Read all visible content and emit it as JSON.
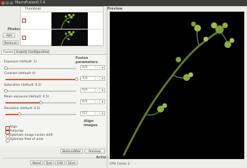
{
  "window": {
    "title": "MacroFusion0.7.4"
  },
  "photos": {
    "label": "Photos",
    "thumbnail_header": "Thumbnail",
    "add_label": "Add",
    "remove_label": "Remove",
    "rows": [
      {
        "checked": true
      },
      {
        "checked": true
      }
    ]
  },
  "tabs": [
    "Fusion",
    "Expert",
    "Configuration"
  ],
  "fusion": {
    "section_title": "Fusion parameters",
    "params": [
      {
        "label": "Exposure (default: 1)",
        "value": "0,0",
        "fraction": 0.0
      },
      {
        "label": "Contrast (default: 0)",
        "value": "1,0",
        "fraction": 1.0
      },
      {
        "label": "Saturation (default: 0.2)",
        "value": "0,0",
        "fraction": 0.0
      },
      {
        "label": "Mean exposure (default: 0.5)",
        "value": "0,5",
        "fraction": 0.5
      },
      {
        "label": "Deviation (default: 0.2)",
        "value": "0,2",
        "fraction": 0.2
      }
    ]
  },
  "align": {
    "section_title": "Align images",
    "options": [
      {
        "label": "Align",
        "type": "checkbox",
        "checked": true
      },
      {
        "label": "Autocrop",
        "type": "checkbox",
        "checked": true
      },
      {
        "label": "Optimize image center shift",
        "type": "radio"
      },
      {
        "label": "Optimize field of view",
        "type": "radio"
      }
    ]
  },
  "buttons": {
    "before_after": "Before/After",
    "preview": "Preview"
  },
  "action": {
    "label": "Action",
    "about": "About",
    "quit": "Quit",
    "edit": "Edit",
    "save": "Save"
  },
  "preview": {
    "label": "Preview",
    "cpu_cores": "CPU Cores: 2"
  },
  "colors": {
    "accent": "#e0592f",
    "titlebar": "#3d3d3b",
    "preview_bg": "#000000"
  }
}
